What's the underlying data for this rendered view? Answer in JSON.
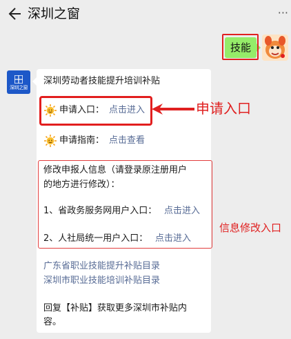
{
  "header": {
    "title": "深圳之窗",
    "more_glyph": "···"
  },
  "sent_message": {
    "text": "技能"
  },
  "bot": {
    "logo_text": "深圳之窗"
  },
  "received_message": {
    "heading": "深圳劳动者技能提升培训补贴",
    "apply_label": "申请入口：",
    "apply_link": "点击进入",
    "guide_label": "申请指南：",
    "guide_link": "点击查看",
    "modify_intro_line1": "修改申报人信息（请登录原注册用户",
    "modify_intro_line2": "的地方进行修改）：",
    "option1_label": "1、省政务服务网用户入口：",
    "option1_link": "点击进入",
    "option2_label": "2、人社局统一用户入口：",
    "option2_link": "点击进入",
    "catalog_link1": "广东省职业技能提升补贴目录",
    "catalog_link2": "深圳市职业技能培训补贴目录",
    "reply_line1": "回复【补贴】获取更多深圳市补贴内",
    "reply_line2": "容。"
  },
  "annotations": {
    "apply_entrance": "申请入口",
    "info_modify_entrance": "信息修改入口"
  },
  "colors": {
    "background": "#ededed",
    "sent_bubble": "#95ec69",
    "link": "#576b95",
    "annotation_red": "#e02020",
    "bot_avatar": "#1d58c8"
  }
}
